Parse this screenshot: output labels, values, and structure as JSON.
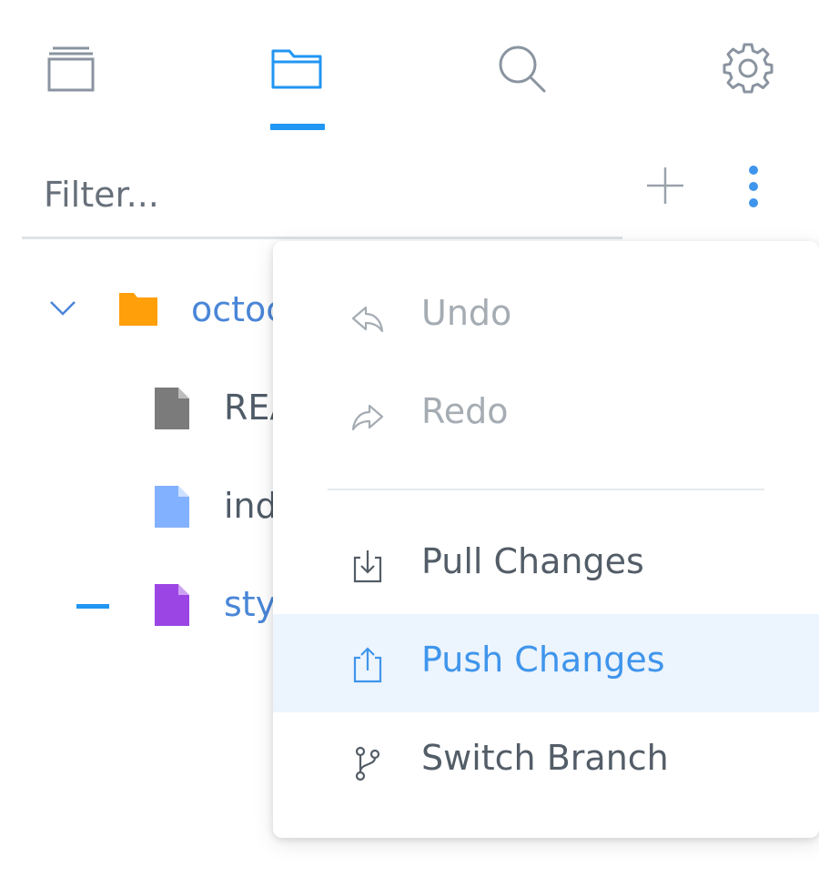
{
  "tabs": [
    {
      "name": "projects",
      "icon": "stack-icon",
      "active": false
    },
    {
      "name": "files",
      "icon": "folder-icon",
      "active": true
    },
    {
      "name": "search",
      "icon": "search-icon",
      "active": false
    },
    {
      "name": "settings",
      "icon": "gear-icon",
      "active": false
    }
  ],
  "filter": {
    "placeholder": "Filter..."
  },
  "tree": {
    "folder": {
      "label": "octoc",
      "icon": "folder-icon",
      "color": "#ff9f0a"
    },
    "files": [
      {
        "label": "REA",
        "icon": "file-icon",
        "color": "#7b7b7b"
      },
      {
        "label": "ind",
        "icon": "file-icon",
        "color": "#82b1ff"
      },
      {
        "label": "sty",
        "icon": "file-icon",
        "color": "#9b45e4"
      }
    ]
  },
  "menu": {
    "items": [
      {
        "label": "Undo",
        "icon": "undo-icon",
        "state": "disabled"
      },
      {
        "label": "Redo",
        "icon": "redo-icon",
        "state": "disabled"
      },
      {
        "label": "Pull Changes",
        "icon": "download-icon",
        "state": "normal"
      },
      {
        "label": "Push Changes",
        "icon": "upload-icon",
        "state": "highlighted"
      },
      {
        "label": "Switch Branch",
        "icon": "branch-icon",
        "state": "normal"
      }
    ]
  },
  "colors": {
    "accent": "#2196f3",
    "icon_gray": "#8a94a0",
    "highlight_bg": "#ecf4fd"
  }
}
